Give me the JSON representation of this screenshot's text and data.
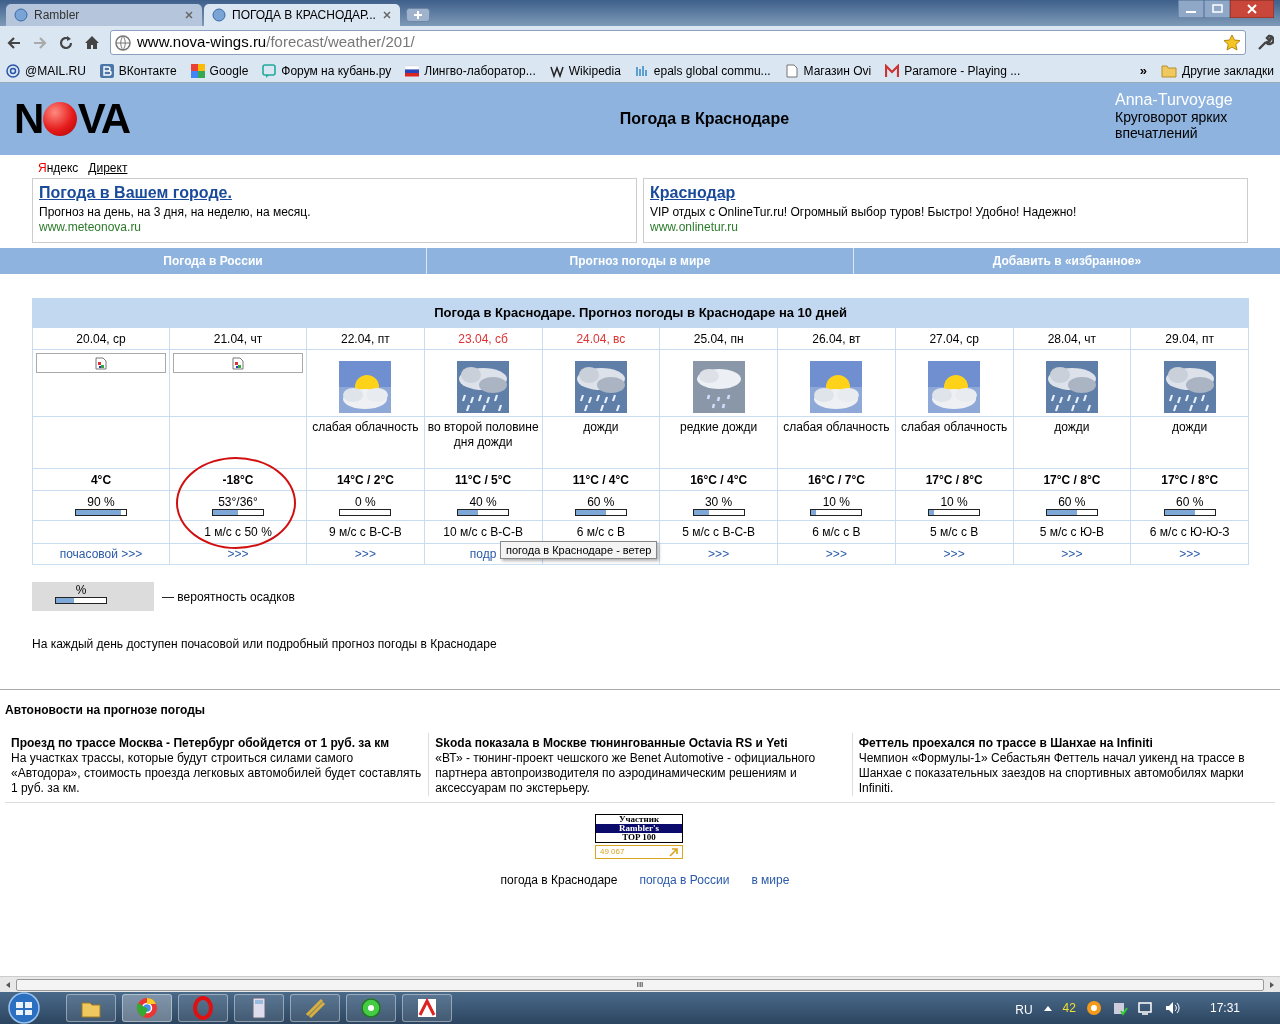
{
  "browser": {
    "tabs": [
      {
        "title": "Rambler",
        "selected": false
      },
      {
        "title": "ПОГОДА В КРАСНОДАР...",
        "selected": true
      }
    ],
    "address": {
      "host": "www.nova-wings.ru",
      "path": "/forecast/weather/201/"
    },
    "bookmarks": [
      {
        "label": "@MAIL.RU",
        "kind": "at"
      },
      {
        "label": "ВКонтакте",
        "kind": "vk"
      },
      {
        "label": "Google",
        "kind": "google"
      },
      {
        "label": "Форум на кубань.ру",
        "kind": "forum"
      },
      {
        "label": "Лингво-лаборатор...",
        "kind": "flag"
      },
      {
        "label": "Wikipedia",
        "kind": "wiki"
      },
      {
        "label": "epals global commu...",
        "kind": "epals"
      },
      {
        "label": "Магазин Ovi",
        "kind": "page"
      },
      {
        "label": "Paramore - Playing ...",
        "kind": "gmail"
      }
    ],
    "more": "»",
    "other_bookmarks": "Другие закладки"
  },
  "header": {
    "logo_start": "N",
    "logo_end": "VA",
    "title": "Погода в Краснодаре",
    "brand": "Anna-Turvoyage",
    "tagline": "Круговорот ярких впечатлений"
  },
  "ads": {
    "provider_first": "Я",
    "provider_rest": "ндекс",
    "direct": "Директ",
    "items": [
      {
        "title": "Погода в Вашем городе.",
        "text": "Прогноз на день, на 3 дня, на неделю, на месяц.",
        "url": "www.meteonova.ru"
      },
      {
        "title": "Краснодар",
        "text": "VIP отдых с OnlineTur.ru! Огромный выбор туров! Быстро! Удобно! Надежно!",
        "url": "www.onlinetur.ru"
      }
    ]
  },
  "nav": [
    "Погода в России",
    "Прогноз погоды в мире",
    "Добавить в «избранное»"
  ],
  "forecast": {
    "title": "Погода в Краснодаре. Прогноз погоды в Краснодаре на 10 дней",
    "days": [
      {
        "date": "20.04, ср",
        "weekend": false,
        "kind": "broken",
        "temp": "4°C",
        "precip": "90 %",
        "level": 0.9,
        "link": "почасовой >>>",
        "circled": false
      },
      {
        "date": "21.04, чт",
        "weekend": false,
        "kind": "broken",
        "temp": "-18°C",
        "precip": "53°/36°",
        "level": 0.5,
        "wind": "1 м/с с 50 %",
        "link": ">>>",
        "circled": true
      },
      {
        "date": "22.04, пт",
        "weekend": false,
        "kind": "sun_cloud",
        "condition": "слабая облачность",
        "temp": "14°C / 2°C",
        "precip": "0 %",
        "level": 0,
        "wind": "9 м/с с В-С-В",
        "link": ">>>",
        "circled": false
      },
      {
        "date": "23.04, сб",
        "weekend": true,
        "kind": "rain",
        "condition": "во второй половине дня дожди",
        "temp": "11°C / 5°C",
        "precip": "40 %",
        "level": 0.4,
        "wind": "10 м/с с В-С-В",
        "link": "подр",
        "circled": false
      },
      {
        "date": "24.04, вс",
        "weekend": true,
        "kind": "rain",
        "condition": "дожди",
        "temp": "11°C / 4°C",
        "precip": "60 %",
        "level": 0.6,
        "wind": "6 м/с с В",
        "circled": false
      },
      {
        "date": "25.04, пн",
        "weekend": false,
        "kind": "light_rain",
        "condition": "редкие дожди",
        "temp": "16°C / 4°C",
        "precip": "30 %",
        "level": 0.3,
        "wind": "5 м/с с В-С-В",
        "link": ">>>",
        "circled": false
      },
      {
        "date": "26.04, вт",
        "weekend": false,
        "kind": "sun_cloud",
        "condition": "слабая облачность",
        "temp": "16°C / 7°C",
        "precip": "10 %",
        "level": 0.1,
        "wind": "6 м/с с В",
        "link": ">>>",
        "circled": false
      },
      {
        "date": "27.04, ср",
        "weekend": false,
        "kind": "sun_cloud",
        "condition": "слабая облачность",
        "temp": "17°C / 8°C",
        "precip": "10 %",
        "level": 0.1,
        "wind": "5 м/с с В",
        "link": ">>>",
        "circled": false
      },
      {
        "date": "28.04, чт",
        "weekend": false,
        "kind": "rain",
        "condition": "дожди",
        "temp": "17°C / 8°C",
        "precip": "60 %",
        "level": 0.6,
        "wind": "5 м/с с Ю-В",
        "link": ">>>",
        "circled": false
      },
      {
        "date": "29.04, пт",
        "weekend": false,
        "kind": "rain",
        "condition": "дожди",
        "temp": "17°C / 8°C",
        "precip": "60 %",
        "level": 0.6,
        "wind": "6 м/с с Ю-Ю-З",
        "link": ">>>",
        "circled": false
      }
    ],
    "tooltip": "погода в Краснодаре - ветер"
  },
  "legend": {
    "symbol": "%",
    "level": 0.35,
    "text": "— вероятность осадков"
  },
  "note": "На каждый день доступен почасовой или подробный прогноз погоды в Краснодаре",
  "news": {
    "heading": "Автоновости на прогнозе погоды",
    "items": [
      {
        "title": "Проезд по трассе Москва - Петербург обойдется от 1 руб. за км",
        "text": "На участках трассы, которые будут строиться силами самого «Автодора», стоимость проезда легковых автомобилей будет составлять 1 руб. за км."
      },
      {
        "title": "Skoda показала в Москве тюнингованные Octavia RS и Yeti",
        "text": "«ВТ» - тюнинг-проект чешского же Benet Automotive - официального партнера автопроизводителя по аэродинамическим решениям и аксессуарам по экстерьеру."
      },
      {
        "title": "Феттель проехался по трассе в Шанхае на Infiniti",
        "text": "Чемпион «Формулы-1» Себастьян Феттель начал уикенд на трассе в Шанхае с показательных заездов на спортивных автомобилях марки Infiniti."
      }
    ]
  },
  "counter": {
    "line_1": "Участник",
    "line_2": "Rambler's",
    "line_3": "TOP 100",
    "count": "49 067"
  },
  "footer": [
    {
      "label": "погода в Краснодаре",
      "kind": "text"
    },
    {
      "label": "погода в России",
      "kind": "link"
    },
    {
      "label": "в мире",
      "kind": "link"
    }
  ],
  "taskbar": {
    "scroll_grip": "III",
    "lang": "RU",
    "tray_number": "42",
    "clock": "17:31"
  }
}
